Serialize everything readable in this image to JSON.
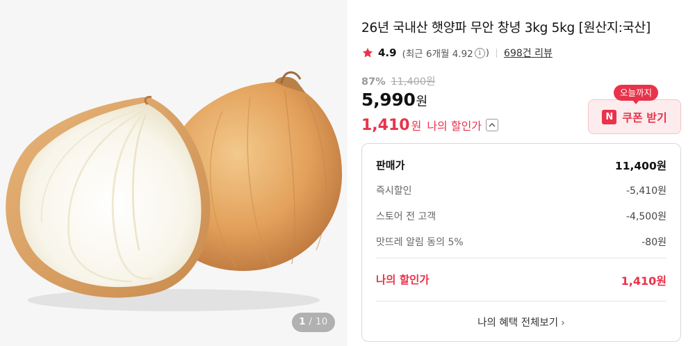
{
  "gallery": {
    "current": "1",
    "separator": "/",
    "total": "10",
    "image_description_icon": "onion-product-image"
  },
  "product": {
    "title": "26년 국내산 햇양파 무안 창녕 3kg 5kg [원산지:국산]",
    "rating": "4.9",
    "recent_rating_prefix": "(최근 6개월 4.92",
    "recent_rating_suffix": ")",
    "review_count": "698건 리뷰",
    "discount_rate": "87%",
    "original_price": "11,400원",
    "sale_price": "5,990",
    "sale_price_unit": "원",
    "my_price": "1,410",
    "my_price_unit": "원",
    "my_price_label": "나의 할인가"
  },
  "coupon": {
    "badge": "오늘까지",
    "n_icon": "N",
    "label": "쿠폰 받기"
  },
  "breakdown": {
    "rows": [
      {
        "label": "판매가",
        "value": "11,400원"
      },
      {
        "label": "즉시할인",
        "value": "-5,410원"
      },
      {
        "label": "스토어 전 고객",
        "value": "-4,500원"
      },
      {
        "label": "맛뜨레 알림 동의 5%",
        "value": "-80원"
      }
    ],
    "final": {
      "label": "나의 할인가",
      "value": "1,410원"
    },
    "see_all": "나의 혜택 전체보기"
  },
  "colors": {
    "accent": "#e8334a",
    "star": "#e8334a",
    "coupon_bg": "#fdecee"
  }
}
